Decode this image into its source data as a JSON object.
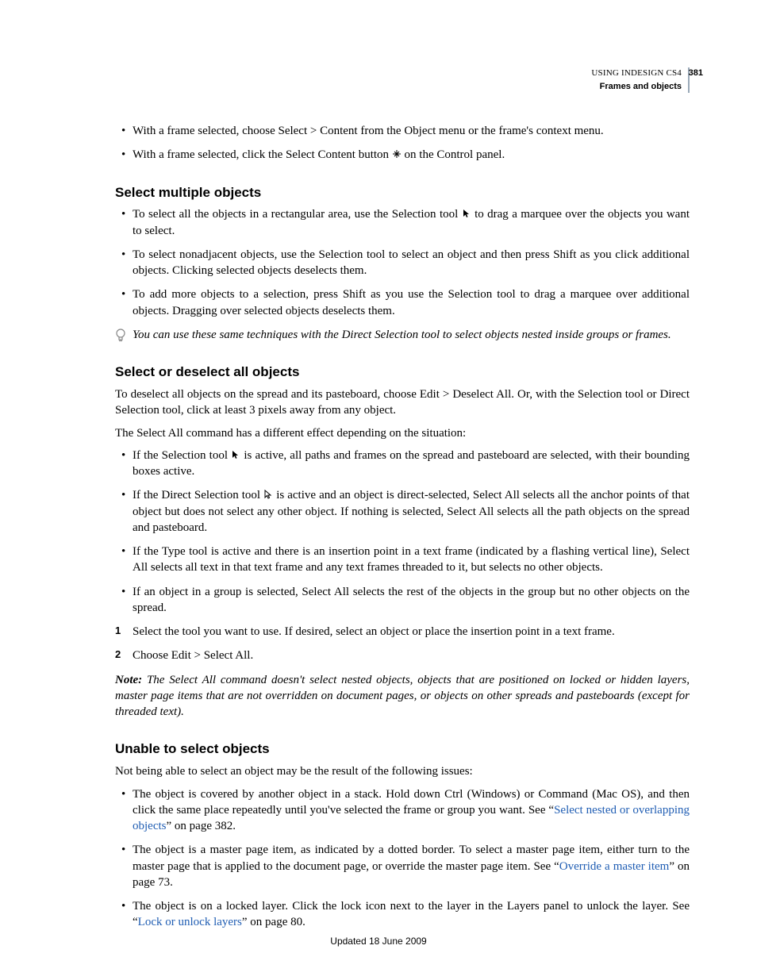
{
  "header": {
    "product": "USING INDESIGN CS4",
    "section": "Frames and objects",
    "page_number": "381"
  },
  "intro_bullets": [
    {
      "text": "With a frame selected, choose Select > Content from the Object menu or the frame's context menu."
    },
    {
      "text_before": "With a frame selected, click the Select Content button ",
      "text_after": " on the Control panel.",
      "icon": "select-content"
    }
  ],
  "section1": {
    "heading": "Select multiple objects",
    "bullets": [
      {
        "text_before": "To select all the objects in a rectangular area, use the Selection tool ",
        "text_after": " to drag a marquee over the objects you want to select.",
        "icon": "selection-tool"
      },
      {
        "text": "To select nonadjacent objects, use the Selection tool to select an object and then press Shift as you click additional objects. Clicking selected objects deselects them."
      },
      {
        "text": "To add more objects to a selection, press Shift as you use the Selection tool to drag a marquee over additional objects. Dragging over selected objects deselects them."
      }
    ],
    "tip": "You can use these same techniques with the Direct Selection tool to select objects nested inside groups or frames."
  },
  "section2": {
    "heading": "Select or deselect all objects",
    "para1": "To deselect all objects on the spread and its pasteboard, choose Edit > Deselect All. Or, with the Selection tool or Direct Selection tool, click at least 3 pixels away from any object.",
    "para2": "The Select All command has a different effect depending on the situation:",
    "bullets": [
      {
        "text_before": "If the Selection tool ",
        "text_after": " is active, all paths and frames on the spread and pasteboard are selected, with their bounding boxes active.",
        "icon": "selection-tool"
      },
      {
        "text_before": "If the Direct Selection tool ",
        "text_after": " is active and an object is direct-selected, Select All selects all the anchor points of that object but does not select any other object. If nothing is selected, Select All selects all the path objects on the spread and pasteboard.",
        "icon": "direct-selection-tool"
      },
      {
        "text": "If the Type tool is active and there is an insertion point in a text frame (indicated by a flashing vertical line), Select All selects all text in that text frame and any text frames threaded to it, but selects no other objects."
      },
      {
        "text": "If an object in a group is selected, Select All selects the rest of the objects in the group but no other objects on the spread."
      }
    ],
    "steps": [
      "Select the tool you want to use. If desired, select an object or place the insertion point in a text frame.",
      "Choose Edit > Select All."
    ],
    "note_label": "Note:",
    "note": " The Select All command doesn't select nested objects, objects that are positioned on locked or hidden layers, master page items that are not overridden on document pages, or objects on other spreads and pasteboards (except for threaded text)."
  },
  "section3": {
    "heading": "Unable to select objects",
    "para1": "Not being able to select an object may be the result of the following issues:",
    "bullets": [
      {
        "before": "The object is covered by another object in a stack. Hold down Ctrl (Windows) or Command (Mac OS), and then click the same place repeatedly until you've selected the frame or group you want. See “",
        "link": "Select nested or overlapping objects",
        "after": "” on page 382."
      },
      {
        "before": "The object is a master page item, as indicated by a dotted border. To select a master page item, either turn to the master page that is applied to the document page, or override the master page item. See “",
        "link": "Override a master item",
        "after": "” on page 73."
      },
      {
        "before": "The object is on a locked layer. Click the lock icon next to the layer in the Layers panel to unlock the layer. See “",
        "link": "Lock or unlock layers",
        "after": "” on page 80."
      }
    ]
  },
  "footer": "Updated 18 June 2009"
}
